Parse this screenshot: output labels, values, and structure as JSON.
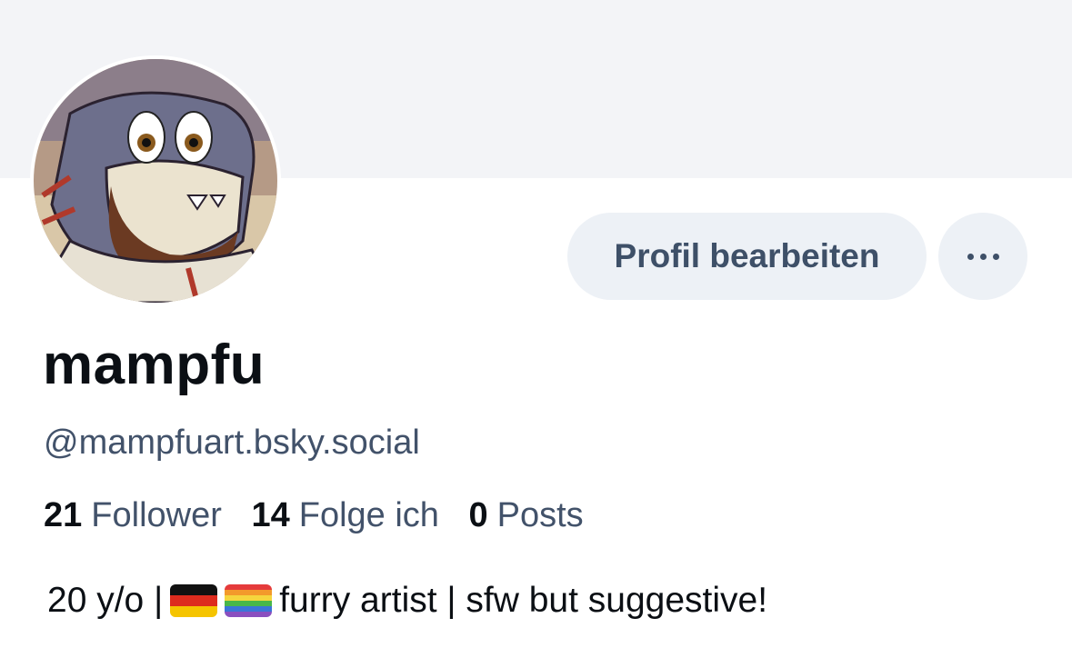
{
  "profile": {
    "display_name": "mampfu",
    "handle": "@mampfuart.bsky.social",
    "edit_button_label": "Profil bearbeiten",
    "more_button_icon": "ellipsis-icon",
    "avatar_icon": "shark-avatar-icon"
  },
  "stats": {
    "followers_count": "21",
    "followers_label": "Follower",
    "following_count": "14",
    "following_label": "Folge ich",
    "posts_count": "0",
    "posts_label": "Posts"
  },
  "bio": {
    "part1": "20 y/o |",
    "flag1_icon": "german-flag-icon",
    "flag2_icon": "rainbow-flag-icon",
    "part2": "furry artist | sfw but suggestive!"
  },
  "colors": {
    "banner": "#f3f4f7",
    "button_bg": "#edf1f6",
    "secondary_text": "#42526a",
    "primary_text": "#0b0f14"
  }
}
